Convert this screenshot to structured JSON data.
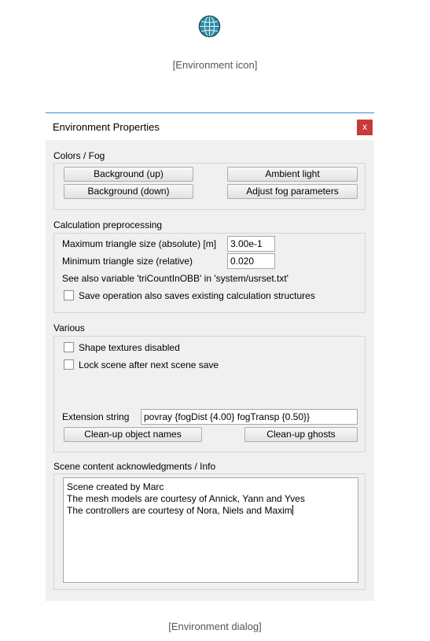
{
  "icon_caption": "[Environment icon]",
  "dialog_caption": "[Environment dialog]",
  "dialog": {
    "title": "Environment Properties",
    "close_label": "x",
    "colors_fog": {
      "title": "Colors / Fog",
      "bg_up": "Background (up)",
      "ambient": "Ambient light",
      "bg_down": "Background (down)",
      "fog": "Adjust fog parameters"
    },
    "calc": {
      "title": "Calculation preprocessing",
      "max_tri_label": "Maximum triangle size (absolute) [m]",
      "max_tri_value": "3.00e-1",
      "min_tri_label": "Minimum triangle size (relative)",
      "min_tri_value": "0.020",
      "see_also": "See also variable 'triCountInOBB' in 'system/usrset.txt'",
      "save_op_label": "Save operation also saves existing calculation structures"
    },
    "various": {
      "title": "Various",
      "shape_textures": "Shape textures disabled",
      "lock_scene": "Lock scene after next scene save",
      "ext_label": "Extension string",
      "ext_value": "povray {fogDist {4.00} fogTransp {0.50}}",
      "cleanup_names": "Clean-up object names",
      "cleanup_ghosts": "Clean-up ghosts"
    },
    "info": {
      "title": "Scene content acknowledgments / Info",
      "lines": [
        "Scene created by Marc",
        "The mesh models are courtesy of Annick, Yann and Yves",
        "The controllers are courtesy of Nora, Niels and Maxim"
      ]
    }
  }
}
